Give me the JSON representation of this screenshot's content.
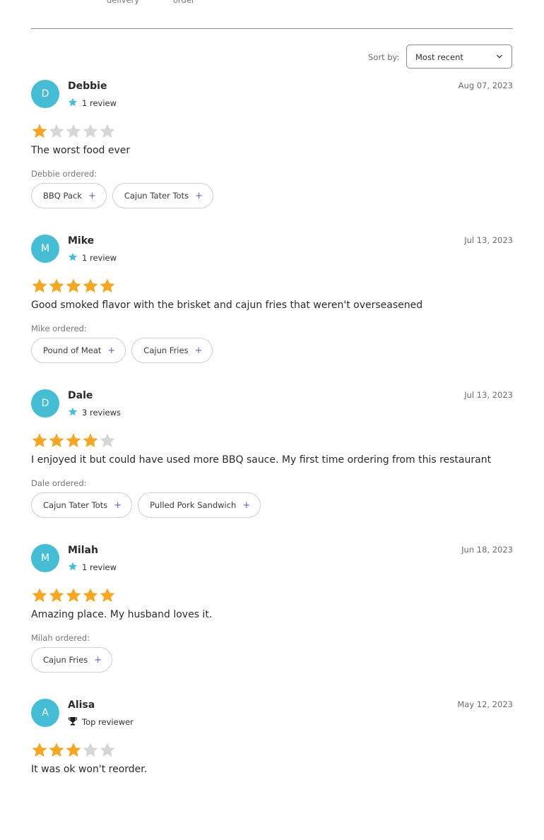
{
  "top_tabs": [
    "delivery",
    "order"
  ],
  "sort": {
    "label": "Sort by:",
    "value": "Most recent"
  },
  "colors": {
    "avatar": "#45bdd4",
    "star_filled": "#f5a623",
    "star_empty": "#d6d6d6",
    "accent": "#5b63c9"
  },
  "reviews": [
    {
      "initial": "D",
      "name": "Debbie",
      "meta_icon": "star-icon",
      "meta": "1 review",
      "date": "Aug 07, 2023",
      "rating": 1,
      "text": "The worst food ever",
      "ordered_label": "Debbie ordered:",
      "items": [
        "BBQ Pack",
        "Cajun Tater Tots"
      ]
    },
    {
      "initial": "M",
      "name": "Mike",
      "meta_icon": "star-icon",
      "meta": "1 review",
      "date": "Jul 13, 2023",
      "rating": 5,
      "text": "Good smoked flavor with the brisket and cajun fries that weren't overseasened",
      "ordered_label": "Mike ordered:",
      "items": [
        "Pound of Meat",
        "Cajun Fries"
      ]
    },
    {
      "initial": "D",
      "name": "Dale",
      "meta_icon": "star-icon",
      "meta": "3 reviews",
      "date": "Jul 13, 2023",
      "rating": 4,
      "text": "I enjoyed it but could have used more BBQ sauce. My first time ordering from this restaurant",
      "ordered_label": "Dale ordered:",
      "items": [
        "Cajun Tater Tots",
        "Pulled Pork Sandwich"
      ]
    },
    {
      "initial": "M",
      "name": "Milah",
      "meta_icon": "star-icon",
      "meta": "1 review",
      "date": "Jun 18, 2023",
      "rating": 5,
      "text": "Amazing place. My husband loves it.",
      "ordered_label": "Milah ordered:",
      "items": [
        "Cajun Fries"
      ]
    },
    {
      "initial": "A",
      "name": "Alisa",
      "meta_icon": "trophy-icon",
      "meta": "Top reviewer",
      "date": "May 12, 2023",
      "rating": 3,
      "text": "It was ok won't reorder.",
      "ordered_label": "",
      "items": []
    }
  ]
}
